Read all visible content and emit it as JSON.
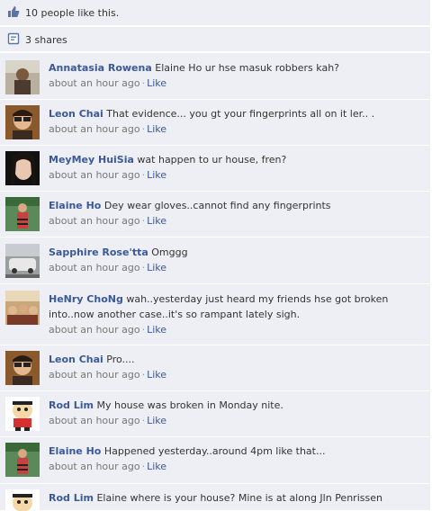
{
  "summary": {
    "likes_text": "10 people like this.",
    "shares_text": "3 shares"
  },
  "comments": [
    {
      "name": "Annatasia Rowena",
      "text": "Elaine Ho ur hse masuk robbers kah?",
      "time": "about an hour ago",
      "like": "Like"
    },
    {
      "name": "Leon Chai",
      "text": "That evidence... you gt your fingerprints all on it ler.. .",
      "time": "about an hour ago",
      "like": "Like"
    },
    {
      "name": "MeyMey HuiSia",
      "text": "wat happen to ur house, fren?",
      "time": "about an hour ago",
      "like": "Like"
    },
    {
      "name": "Elaine Ho",
      "text": "Dey wear gloves..cannot find any fingerprints",
      "time": "about an hour ago",
      "like": "Like"
    },
    {
      "name": "Sapphire Rose'tta",
      "text": "Omggg",
      "time": "about an hour ago",
      "like": "Like"
    },
    {
      "name": "HeNry ChoNg",
      "text": "wah..yesterday just heard my friends hse got broken into..now another case..it's so rampant lately sigh.",
      "time": "about an hour ago",
      "like": "Like"
    },
    {
      "name": "Leon Chai",
      "text": "Pro....",
      "time": "about an hour ago",
      "like": "Like"
    },
    {
      "name": "Rod Lim",
      "text": "My house was broken in Monday nite.",
      "time": "about an hour ago",
      "like": "Like"
    },
    {
      "name": "Elaine Ho",
      "text": "Happened yesterday..around 4pm like that...",
      "time": "about an hour ago",
      "like": "Like"
    },
    {
      "name": "Rod Lim",
      "text": "Elaine where is your house? Mine is at along Jln Penrissen",
      "time": "",
      "like": ""
    }
  ]
}
